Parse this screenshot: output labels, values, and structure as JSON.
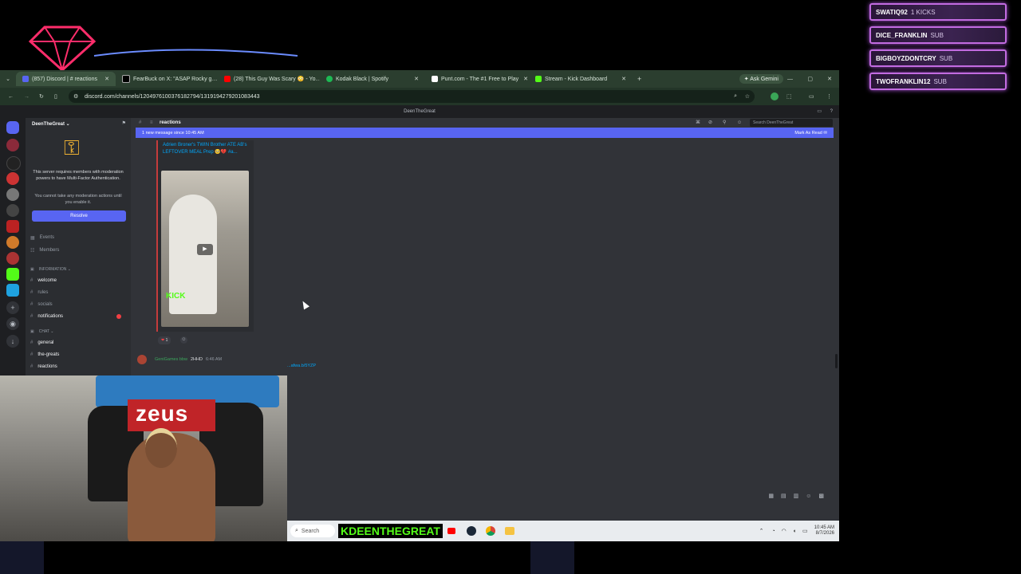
{
  "overlay": {
    "alerts": [
      {
        "name": "SWATIQ92",
        "event": "1 KICKS"
      },
      {
        "name": "DICE_FRANKLIN",
        "event": "SUB"
      },
      {
        "name": "BIGBOYZDONTCRY",
        "event": "SUB"
      },
      {
        "name": "TWOFRANKLIN12",
        "event": "SUB"
      }
    ],
    "streamer_handle": "KDEENTHEGREAT"
  },
  "browser": {
    "tabs": [
      {
        "label": "(857) Discord | # reactions",
        "active": true,
        "color": "#5865f2"
      },
      {
        "label": "FearBuck on X: \"ASAP Rocky g…",
        "active": false,
        "color": "#000000"
      },
      {
        "label": "(28) This Guy Was Scary 😳 - Yo…",
        "active": false,
        "color": "#ff0000"
      },
      {
        "label": "Kodak Black | Spotify",
        "active": false,
        "color": "#1db954"
      },
      {
        "label": "Punt.com - The #1 Free to Play",
        "active": false,
        "color": "#ffffff"
      },
      {
        "label": "Stream - Kick Dashboard",
        "active": false,
        "color": "#53fc18"
      }
    ],
    "ask_gemini": "Ask Gemini",
    "url": "discord.com/channels/1204976100376182794/1319194279201083443"
  },
  "discord": {
    "window_title": "DeenTheGreat",
    "server_name": "DeenTheGreat",
    "mfa_notice": "This server requires members with moderation powers to have Multi-Factor Authentication.",
    "mfa_subnotice": "You cannot take any moderation actions until you enable it.",
    "resolve_button": "Resolve",
    "nav": [
      {
        "label": "Events"
      },
      {
        "label": "Members"
      }
    ],
    "categories": [
      {
        "label": "INFORMATION ⌄",
        "channels": [
          {
            "label": "welcome",
            "bright": true
          },
          {
            "label": "rules",
            "bright": false
          },
          {
            "label": "socials",
            "bright": false
          },
          {
            "label": "notifications",
            "bright": true
          }
        ]
      },
      {
        "label": "CHAT ⌄",
        "channels": [
          {
            "label": "general",
            "bright": true
          },
          {
            "label": "the-greats",
            "bright": true
          },
          {
            "label": "reactions",
            "bright": true
          }
        ]
      }
    ],
    "channel_name": "reactions",
    "search_placeholder": "Search DeenTheGreat",
    "new_messages": "1 new message since 10:45 AM",
    "mark_as_read": "Mark As Read",
    "message": {
      "embed_title": "Adrien Broner's TWIN Brother ATE AB's LEFTOVER MEAL Prep 🥺💔 #a...",
      "video_watermark": "KICK",
      "reaction_count": "1"
    },
    "next_message": {
      "author": "GeniGames bbw",
      "tag": "2HHD",
      "time": "6:46 AM",
      "link_fragment": "...afwa.b/5YZP"
    }
  },
  "webcam": {
    "banner_text": "zeus"
  },
  "taskbar": {
    "search_placeholder": "Search",
    "time": "10:45 AM",
    "date": "8/7/2026"
  }
}
